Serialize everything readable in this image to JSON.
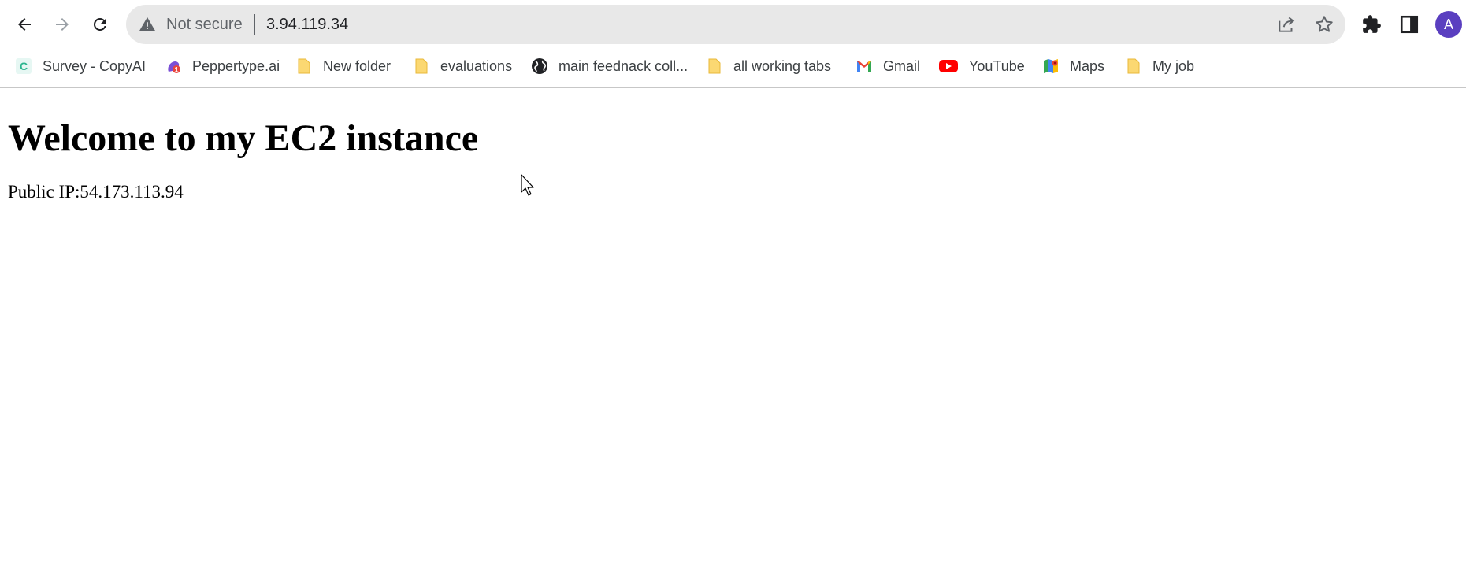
{
  "browser": {
    "address_bar": {
      "security_label": "Not secure",
      "url": "3.94.119.34"
    },
    "profile_initial": "A",
    "bookmarks": [
      {
        "label": "Survey - CopyAI",
        "icon": "copyai-icon"
      },
      {
        "label": "Peppertype.ai",
        "icon": "peppertype-icon"
      },
      {
        "label": "New folder",
        "icon": "folder-icon"
      },
      {
        "label": "evaluations",
        "icon": "folder-icon"
      },
      {
        "label": "main feednack coll...",
        "icon": "globe-icon"
      },
      {
        "label": "all working tabs",
        "icon": "folder-icon"
      },
      {
        "label": "Gmail",
        "icon": "gmail-icon"
      },
      {
        "label": "YouTube",
        "icon": "youtube-icon"
      },
      {
        "label": "Maps",
        "icon": "maps-icon"
      },
      {
        "label": "My job",
        "icon": "folder-icon"
      }
    ],
    "colors": {
      "omnibox_bg": "#e8e8e8",
      "avatar_bg": "#5a3fc0",
      "folder": "#fbd872"
    }
  },
  "page": {
    "heading": "Welcome to my EC2 instance",
    "ip_label": "Public IP:",
    "ip_value": "54.173.113.94"
  }
}
